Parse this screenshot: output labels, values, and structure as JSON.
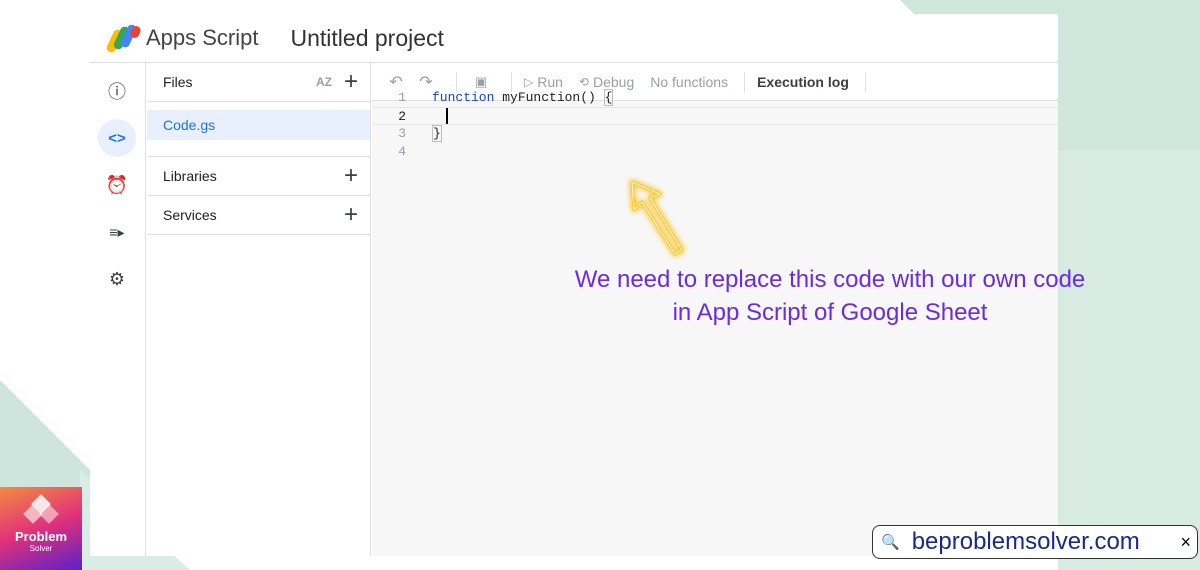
{
  "app": {
    "name": "Apps Script",
    "project_title": "Untitled project"
  },
  "rail": {
    "items": [
      {
        "icon": "info-icon",
        "glyph": "ⓘ"
      },
      {
        "icon": "code-icon",
        "glyph": "<>",
        "active": true
      },
      {
        "icon": "alarm-clock-icon",
        "glyph": "⏰"
      },
      {
        "icon": "executions-icon",
        "glyph": "≡▸"
      },
      {
        "icon": "gear-icon",
        "glyph": "⚙"
      }
    ]
  },
  "files_panel": {
    "files_label": "Files",
    "sort_label": "AZ",
    "add_glyph": "+",
    "file_name": "Code.gs",
    "libraries_label": "Libraries",
    "services_label": "Services"
  },
  "toolbar": {
    "undo_glyph": "↶",
    "redo_glyph": "↷",
    "save_glyph": "💾",
    "run_label": "Run",
    "debug_label": "Debug",
    "functions_label": "No functions",
    "execution_log_label": "Execution log"
  },
  "editor": {
    "lines": [
      {
        "num": "1",
        "keyword": "function",
        "rest": " myFunction() ",
        "brace": "{"
      },
      {
        "num": "2"
      },
      {
        "num": "3",
        "brace": "}"
      },
      {
        "num": "4"
      }
    ]
  },
  "annotation": {
    "line1": "We need to replace this code with our own code",
    "line2": "in App Script of Google Sheet",
    "color": "#6a2be3"
  },
  "brand": {
    "title": "Problem",
    "subtitle": "Solver"
  },
  "search": {
    "url": "beproblemsolver.com",
    "close_glyph": "×"
  }
}
